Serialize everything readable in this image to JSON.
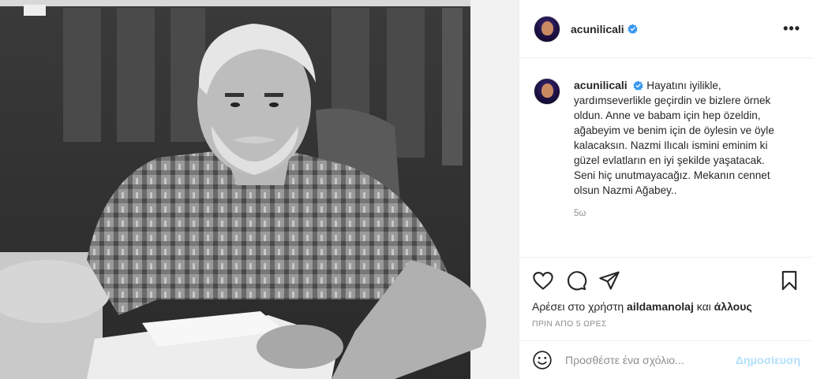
{
  "post": {
    "username": "acunilicali",
    "verified": true,
    "more_options": "•••",
    "caption": "Hayatını iyilikle, yardımseverlikle geçirdin ve bizlere örnek oldun. Anne ve babam için hep özeldin, ağabeyim ve benim için de öylesin ve öyle kalacaksın. Nazmi Ilıcalı ismini eminim ki güzel evlatların en iyi şekilde yaşatacak. Seni hiç unutmayacağız. Mekanın cennet olsun Nazmi Ağabey..",
    "caption_age": "5ω"
  },
  "likes": {
    "prefix": "Αρέσει στο χρήστη",
    "user": "aildamanolaj",
    "conjunction": "και",
    "others": "άλλους"
  },
  "timestamp": "ΠΡΙΝ ΑΠΟ 5 ΩΡΕΣ",
  "comment": {
    "placeholder": "Προσθέστε ένα σχόλιο...",
    "publish_label": "Δημοσίευση"
  },
  "colors": {
    "verified_blue": "#3897f0",
    "publish_disabled": "#b2dffc",
    "secondary_text": "#8e8e8e"
  },
  "icons": [
    "heart-icon",
    "comment-icon",
    "share-icon",
    "bookmark-icon",
    "emoji-icon",
    "verified-badge-icon"
  ]
}
